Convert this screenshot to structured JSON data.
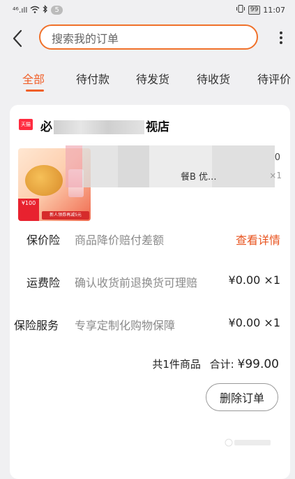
{
  "status_bar": {
    "signal": "⁴⁶.ıll",
    "notification_count": "5",
    "battery": "99",
    "time": "11:07"
  },
  "search": {
    "placeholder": "搜索我的订单"
  },
  "tabs": [
    {
      "label": "全部",
      "active": true
    },
    {
      "label": "待付款",
      "active": false
    },
    {
      "label": "待发货",
      "active": false
    },
    {
      "label": "待收货",
      "active": false
    },
    {
      "label": "待评价",
      "active": false
    }
  ],
  "order": {
    "store_badge": "天猫",
    "shop_name_start": "必",
    "shop_name_end": "视店",
    "product_title_visible": "餐B 优...",
    "product_price_fragment": "0",
    "product_qty": "×1",
    "image_tag_price": "¥100",
    "image_promo": "新人领券再减5元",
    "services": [
      {
        "label": "保价险",
        "desc": "商品降价赔付差额",
        "right": "查看详情"
      },
      {
        "label": "运费险",
        "desc": "确认收货前退换货可理赔",
        "right": "¥0.00 ×1"
      },
      {
        "label": "保险服务",
        "desc": "专享定制化购物保障",
        "right": "¥0.00 ×1"
      }
    ],
    "summary_count": "共1件商品",
    "summary_total_label": "合计:",
    "summary_total": "¥99.00",
    "delete_button": "删除订单"
  },
  "colors": {
    "accent": "#f0602a",
    "tmall_red": "#ff2b3f"
  }
}
